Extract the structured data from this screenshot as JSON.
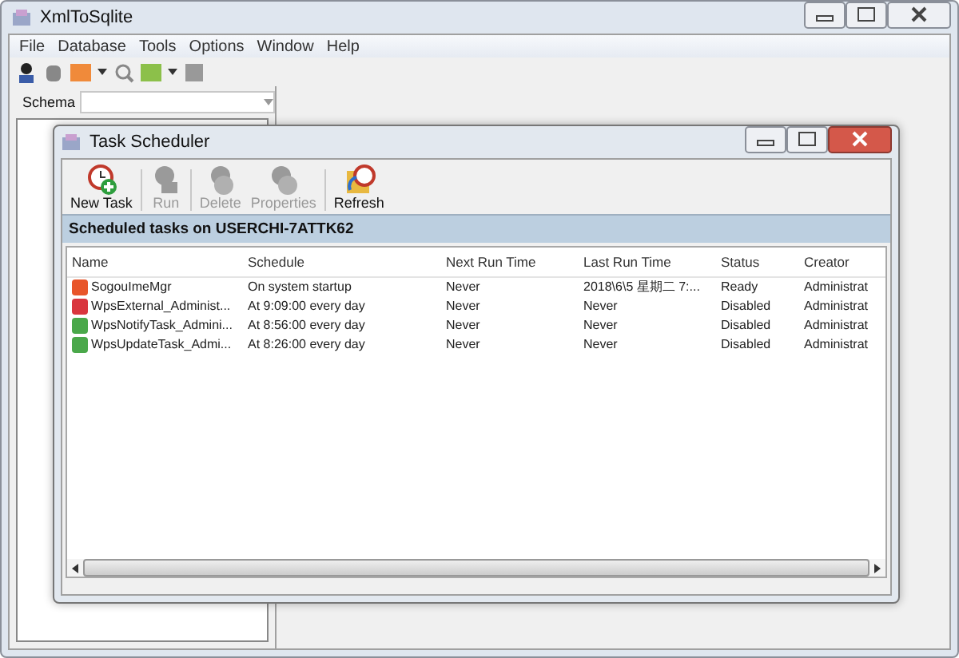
{
  "window": {
    "title": "XmlToSqlite"
  },
  "menu": [
    "File",
    "Database",
    "Tools",
    "Options",
    "Window",
    "Help"
  ],
  "schema": {
    "label": "Schema"
  },
  "dialog": {
    "title": "Task Scheduler",
    "toolbar": [
      {
        "label": "New Task",
        "kind": "new",
        "disabled": false
      },
      {
        "label": "Run",
        "kind": "run",
        "disabled": true
      },
      {
        "label": "Delete",
        "kind": "delete",
        "disabled": true
      },
      {
        "label": "Properties",
        "kind": "properties",
        "disabled": true
      },
      {
        "label": "Refresh",
        "kind": "refresh",
        "disabled": false
      }
    ],
    "heading": "Scheduled tasks on USERCHI-7ATTK62",
    "columns": [
      "Name",
      "Schedule",
      "Next Run Time",
      "Last Run Time",
      "Status",
      "Creator"
    ],
    "rows": [
      {
        "color": "#e8552a",
        "cells": [
          "SogouImeMgr",
          "On system startup",
          "Never",
          "2018\\6\\5 星期二 7:...",
          "Ready",
          "Administrat"
        ]
      },
      {
        "color": "#d9363e",
        "cells": [
          "WpsExternal_Administ...",
          "At 9:09:00 every day",
          "Never",
          "Never",
          "Disabled",
          "Administrat"
        ]
      },
      {
        "color": "#4aa84a",
        "cells": [
          "WpsNotifyTask_Admini...",
          "At 8:56:00 every day",
          "Never",
          "Never",
          "Disabled",
          "Administrat"
        ]
      },
      {
        "color": "#4aa84a",
        "cells": [
          "WpsUpdateTask_Admi...",
          "At 8:26:00 every day",
          "Never",
          "Never",
          "Disabled",
          "Administrat"
        ]
      }
    ]
  }
}
